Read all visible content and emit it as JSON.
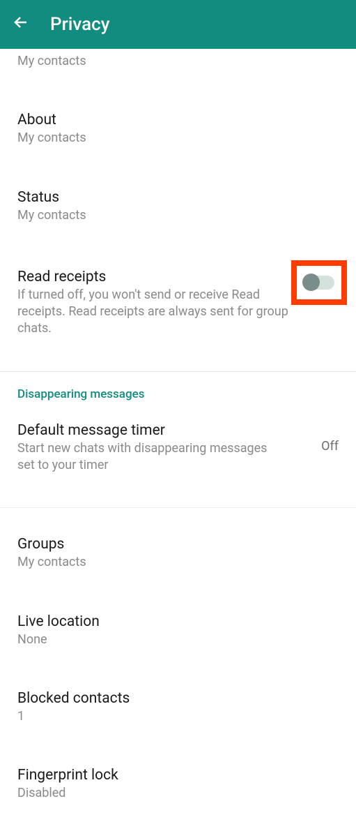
{
  "header": {
    "title": "Privacy"
  },
  "settings": {
    "cut_item": {
      "subtitle": "My contacts"
    },
    "about": {
      "title": "About",
      "subtitle": "My contacts"
    },
    "status": {
      "title": "Status",
      "subtitle": "My contacts"
    },
    "read_receipts": {
      "title": "Read receipts",
      "description": "If turned off, you won't send or receive Read receipts. Read receipts are always sent for group chats.",
      "enabled": false
    },
    "disappearing_header": "Disappearing messages",
    "default_timer": {
      "title": "Default message timer",
      "description": "Start new chats with disappearing messages set to your timer",
      "value": "Off"
    },
    "groups": {
      "title": "Groups",
      "subtitle": "My contacts"
    },
    "live_location": {
      "title": "Live location",
      "subtitle": "None"
    },
    "blocked": {
      "title": "Blocked contacts",
      "subtitle": "1"
    },
    "fingerprint": {
      "title": "Fingerprint lock",
      "subtitle": "Disabled"
    }
  }
}
